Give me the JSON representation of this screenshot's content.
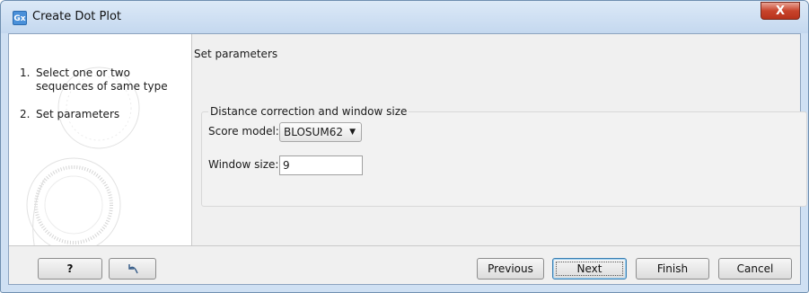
{
  "window": {
    "title": "Create Dot Plot",
    "app_icon_text": "Gx",
    "close_symbol": "X"
  },
  "steps": [
    {
      "number": "1.",
      "label": "Select one or two sequences of same type"
    },
    {
      "number": "2.",
      "label": "Set parameters"
    }
  ],
  "content": {
    "section_title": "Set parameters",
    "group_title": "Distance correction and window size",
    "score_model": {
      "label": "Score model:",
      "value": "BLOSUM62"
    },
    "window_size": {
      "label": "Window size:",
      "value": "9"
    }
  },
  "footer": {
    "help_label": "?",
    "previous_label": "Previous",
    "next_label": "Next",
    "finish_label": "Finish",
    "cancel_label": "Cancel"
  },
  "icons": {
    "help": "question-mark-icon",
    "reset": "reset-arrow-icon",
    "caret": "chevron-down-icon"
  },
  "colors": {
    "titlebar": "#c4d8ef",
    "close_button": "#c8442c",
    "default_button_border": "#3c7fb1"
  }
}
